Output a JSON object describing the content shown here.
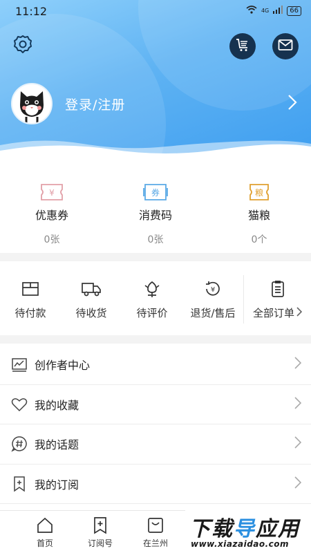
{
  "status_bar": {
    "time": "11:12",
    "signal_label": "4G",
    "battery": "66"
  },
  "header": {
    "login_text": "登录/注册",
    "icons": {
      "settings": "gear-icon",
      "cart": "cart-list-icon",
      "mail": "mail-icon"
    },
    "colors": {
      "gradient_start": "#8fd0fb",
      "gradient_end": "#3e9ef0",
      "button_bg": "#16324f"
    }
  },
  "assets": [
    {
      "label": "优惠券",
      "value": "0张",
      "icon": "coupon-icon",
      "icon_text": "¥",
      "color": "#e2a0a8"
    },
    {
      "label": "消费码",
      "value": "0张",
      "icon": "voucher-code-icon",
      "icon_text": "券",
      "color": "#5aa9e6"
    },
    {
      "label": "猫粮",
      "value": "0个",
      "icon": "cat-food-icon",
      "icon_text": "粮",
      "color": "#e0a030"
    }
  ],
  "orders": [
    {
      "label": "待付款",
      "icon": "wallet-icon"
    },
    {
      "label": "待收货",
      "icon": "truck-icon"
    },
    {
      "label": "待评价",
      "icon": "flower-icon"
    },
    {
      "label": "退货/售后",
      "icon": "refund-icon"
    }
  ],
  "orders_all": {
    "label": "全部订单",
    "icon": "clipboard-icon"
  },
  "menu": [
    {
      "label": "创作者中心",
      "icon": "chart-icon"
    },
    {
      "label": "我的收藏",
      "icon": "heart-icon"
    },
    {
      "label": "我的话题",
      "icon": "hashtag-icon"
    },
    {
      "label": "我的订阅",
      "icon": "bookmark-plus-icon"
    }
  ],
  "bottom_nav": [
    {
      "label": "首页",
      "icon": "home-icon"
    },
    {
      "label": "订阅号",
      "icon": "subscribe-icon"
    },
    {
      "label": "在兰州",
      "icon": "local-icon"
    }
  ],
  "watermark": {
    "main_left": "下载",
    "main_mid": "导",
    "main_right": "应用",
    "sub": "www.xiazaidao.com"
  }
}
